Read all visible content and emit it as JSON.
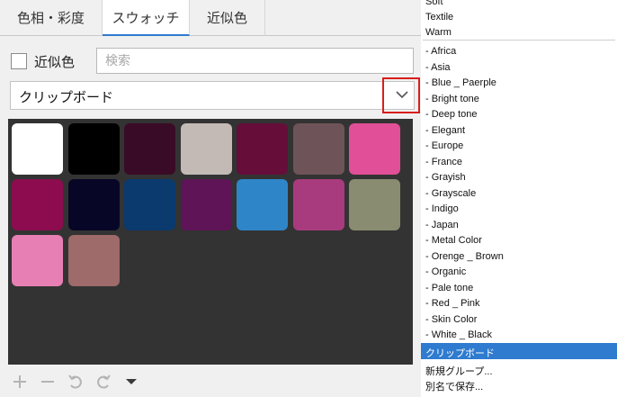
{
  "tabs": [
    {
      "label": "色相・彩度"
    },
    {
      "label": "スウォッチ"
    },
    {
      "label": "近似色"
    }
  ],
  "near_color": {
    "label": "近似色",
    "checked": false
  },
  "search": {
    "placeholder": "検索",
    "value": ""
  },
  "palette_select": {
    "value": "クリップボード"
  },
  "swatches": [
    "#ffffff",
    "#000000",
    "#3a0b26",
    "#c3bab6",
    "#660d3a",
    "#6e5458",
    "#e04f97",
    "#8c0c4f",
    "#080626",
    "#0a3a6e",
    "#5e1456",
    "#2e86c8",
    "#a83b7e",
    "#8a8c72",
    "#e87fb4",
    "#9e6a6a"
  ],
  "toolbar": {
    "icons": [
      "plus-icon",
      "minus-icon",
      "undo-icon",
      "redo-icon",
      "menu-triangle-icon"
    ]
  },
  "palette_list": {
    "top_items": [
      "Soft",
      "Textile",
      "Warm"
    ],
    "items": [
      "- Africa",
      "- Asia",
      "- Blue _ Paerple",
      "- Bright tone",
      "- Deep tone",
      "- Elegant",
      "- Europe",
      "- France",
      "- Grayish",
      "- Grayscale",
      "- Indigo",
      "- Japan",
      "- Metal Color",
      "- Orenge _ Brown",
      "- Organic",
      "- Pale tone",
      "- Red _ Pink",
      "- Skin Color",
      "- White _ Black"
    ],
    "selected": "クリップボード",
    "actions": [
      "新規グループ...",
      "別名で保存..."
    ]
  },
  "colors": {
    "accent": "#2e7bcf",
    "highlight": "#d81d1d",
    "grid_bg": "#333333"
  }
}
